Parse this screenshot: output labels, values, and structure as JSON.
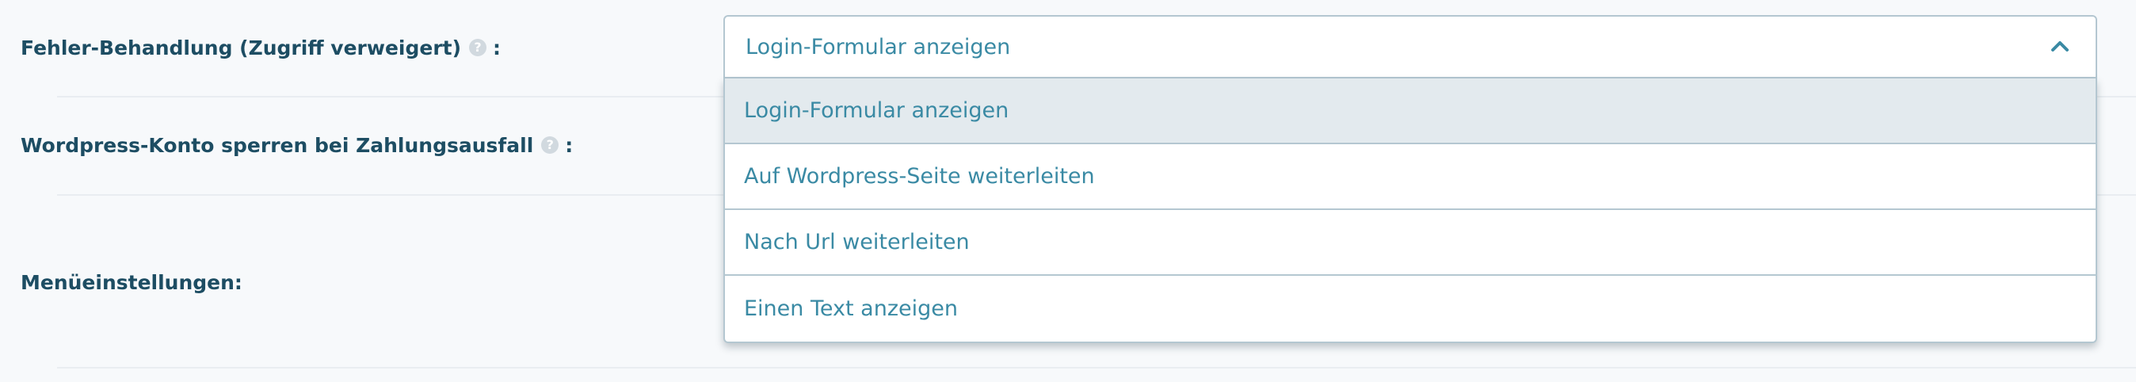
{
  "settings": {
    "rows": [
      {
        "label": "Fehler-Behandlung (Zugriff verweigert)",
        "has_help": true,
        "colon": ":"
      },
      {
        "label": "Wordpress-Konto sperren bei Zahlungsausfall",
        "has_help": true,
        "colon": ":"
      },
      {
        "label": "Menüeinstellungen:",
        "has_help": false
      }
    ],
    "help_glyph": "?"
  },
  "dropdown": {
    "selected_value": "Login-Formular anzeigen",
    "expanded": true,
    "options": [
      {
        "label": "Login-Formular anzeigen",
        "selected": true
      },
      {
        "label": "Auf Wordpress-Seite weiterleiten",
        "selected": false
      },
      {
        "label": "Nach Url weiterleiten",
        "selected": false
      },
      {
        "label": "Einen Text anzeigen",
        "selected": false
      }
    ]
  },
  "icons": {
    "help": "question-circle-icon",
    "chevron": "chevron-up-icon"
  },
  "colors": {
    "label": "#1d4d63",
    "link": "#3a8aa4",
    "selected_bg": "#e3eaee",
    "border": "#b4c7d1",
    "page_bg": "#f7f9fb"
  }
}
